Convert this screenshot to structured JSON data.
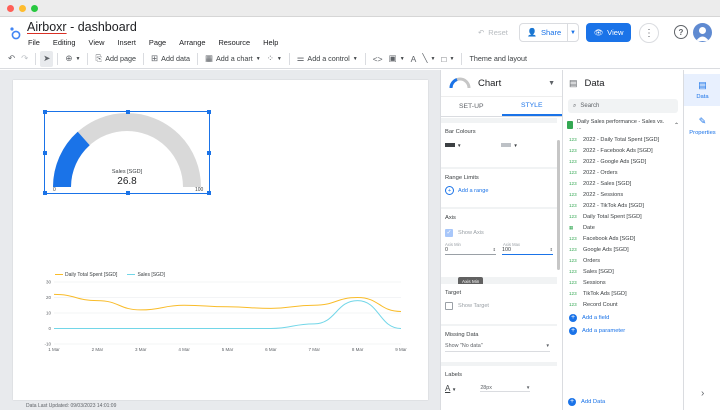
{
  "window": {
    "traffic_colors": [
      "#ff5f57",
      "#febc2e",
      "#28c840"
    ]
  },
  "app": {
    "brand": "Airboxr",
    "title_rest": " - dashboard",
    "menu": [
      "File",
      "Editing",
      "View",
      "Insert",
      "Page",
      "Arrange",
      "Resource",
      "Help"
    ],
    "reset_label": "Reset",
    "share_label": "Share",
    "view_label": "View",
    "accent": "#1a73e8"
  },
  "toolbar": {
    "add_page": "Add page",
    "add_data": "Add data",
    "add_chart": "Add a chart",
    "add_control": "Add a control",
    "theme": "Theme and layout"
  },
  "canvas": {
    "gauge": {
      "label": "Sales [SGD]",
      "value": "26.8",
      "min": "0",
      "max": "100",
      "value_fraction": 0.268
    },
    "footnote": "Data Last Updated: 09/03/2023 14:01:09"
  },
  "chart_data": {
    "type": "line",
    "x": [
      "1 Mar",
      "2 Mar",
      "3 Mar",
      "4 Mar",
      "5 Mar",
      "6 Mar",
      "7 Mar",
      "8 Mar",
      "9 Mar"
    ],
    "yticks": [
      "30",
      "20",
      "10",
      "0",
      "-10"
    ],
    "ylim": [
      -10,
      30
    ],
    "series": [
      {
        "name": "Daily Total Spent [SGD]",
        "color": "#f9bc2a",
        "values": [
          22,
          18,
          12,
          15,
          14,
          13,
          15,
          20,
          11
        ]
      },
      {
        "name": "Sales [SGD]",
        "color": "#72d6e8",
        "values": [
          0,
          0,
          0,
          0,
          0,
          0,
          3,
          18,
          0
        ]
      }
    ],
    "legend": "top-left"
  },
  "props_panel": {
    "title": "Chart",
    "tabs": [
      "SET-UP",
      "STYLE"
    ],
    "bar_colours": "Bar Colours",
    "range_limits": "Range Limits",
    "add_range": "Add a range",
    "axis": "Axis",
    "show_axis": "Show Axis",
    "axis_min_label": "Axis Min",
    "axis_max_label": "Axis Max",
    "axis_min_value": "0",
    "axis_max_value": "100",
    "tooltip": "Axis Min",
    "target": "Target",
    "show_target": "Show Target",
    "missing_data": "Missing Data",
    "missing_value": "Show \"No data\"",
    "labels": "Labels",
    "font_size": "28px"
  },
  "data_panel": {
    "title": "Data",
    "search_placeholder": "Search",
    "source": "Daily Sales performance - Sales vs. ...",
    "fields": [
      {
        "type": "123",
        "name": "2022 - Daily Total Spent [SGD]"
      },
      {
        "type": "123",
        "name": "2022 - Facebook Ads [SGD]"
      },
      {
        "type": "123",
        "name": "2022 - Google Ads [SGD]"
      },
      {
        "type": "123",
        "name": "2022 - Orders"
      },
      {
        "type": "123",
        "name": "2022 - Sales [SGD]"
      },
      {
        "type": "123",
        "name": "2022 - Sessions"
      },
      {
        "type": "123",
        "name": "2022 - TikTok Ads [SGD]"
      },
      {
        "type": "123",
        "name": "Daily Total Spent [SGD]"
      },
      {
        "type": "date",
        "name": "Date"
      },
      {
        "type": "123",
        "name": "Facebook Ads [SGD]"
      },
      {
        "type": "123",
        "name": "Google Ads [SGD]"
      },
      {
        "type": "123",
        "name": "Orders"
      },
      {
        "type": "123",
        "name": "Sales [SGD]"
      },
      {
        "type": "123",
        "name": "Sessions"
      },
      {
        "type": "123",
        "name": "TikTok Ads [SGD]"
      },
      {
        "type": "123",
        "name": "Record Count"
      }
    ],
    "add_field": "Add a field",
    "add_parameter": "Add a parameter",
    "add_data": "Add Data"
  },
  "rail": {
    "data": "Data",
    "properties": "Properties"
  }
}
